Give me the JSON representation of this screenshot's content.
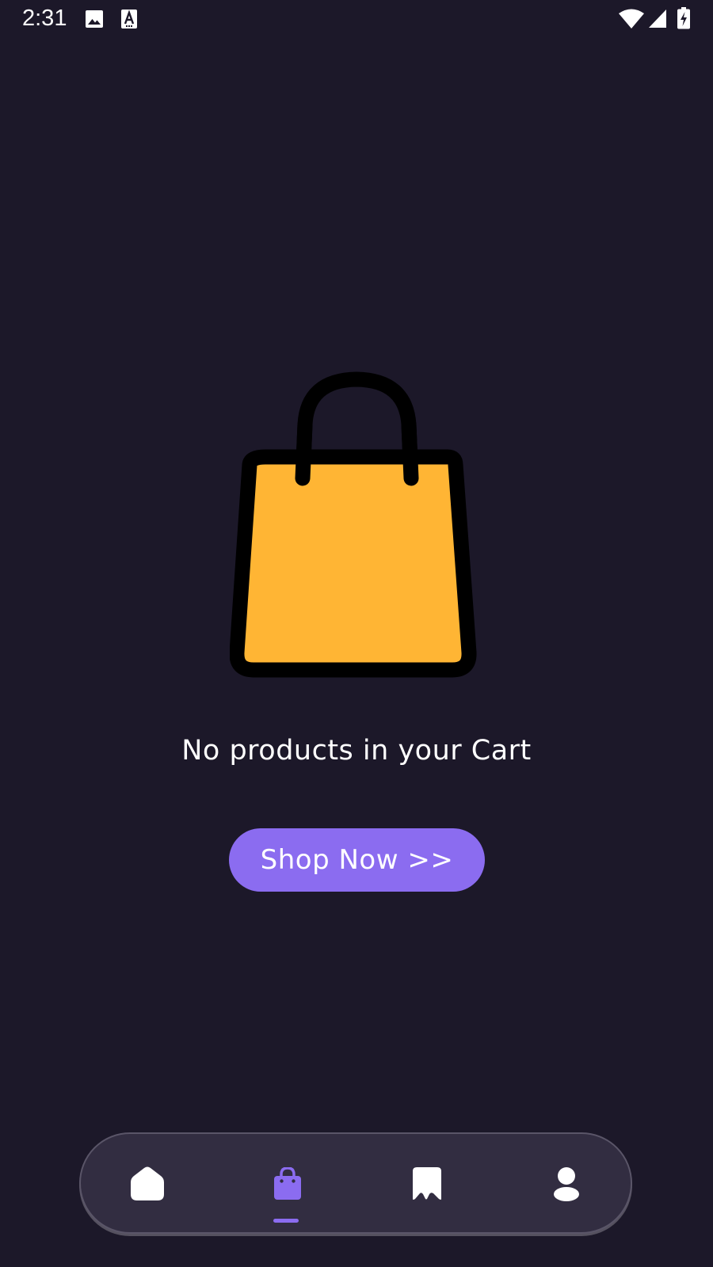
{
  "status_bar": {
    "time": "2:31",
    "left_icons": [
      "image-icon",
      "text-a-icon"
    ],
    "right_icons": [
      "wifi-icon",
      "signal-icon",
      "battery-charging-icon"
    ]
  },
  "empty_cart": {
    "illustration_icon": "shopping-bag-icon",
    "message": "No products in your Cart",
    "button_label": "Shop Now >>"
  },
  "bottom_nav": {
    "items": [
      {
        "name": "home",
        "icon": "home-icon",
        "active": false
      },
      {
        "name": "cart",
        "icon": "shopping-bag-icon",
        "active": true
      },
      {
        "name": "bookmarks",
        "icon": "bookmark-icon",
        "active": false
      },
      {
        "name": "profile",
        "icon": "user-icon",
        "active": false
      }
    ]
  },
  "colors": {
    "background": "#1c1829",
    "accent": "#8b6cf0",
    "bag_fill": "#ffb534",
    "nav_background": "#322d41"
  }
}
